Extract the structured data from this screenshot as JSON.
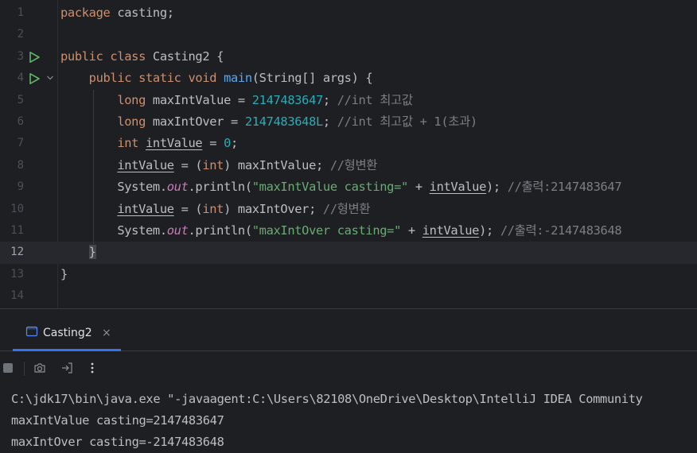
{
  "editor": {
    "lines": [
      {
        "n": "1",
        "html": "<span class=\"kw\">package</span> casting;"
      },
      {
        "n": "2",
        "html": ""
      },
      {
        "n": "3",
        "html": "<span class=\"kw\">public class</span> Casting2 {"
      },
      {
        "n": "4",
        "html": "    <span class=\"kw\">public static void</span> <span class=\"fn\">main</span>(String[] args) {"
      },
      {
        "n": "5",
        "html": "        <span class=\"kw\">long</span> maxIntValue = <span class=\"num\">2147483647</span>; <span class=\"cmt\">//int 최고값</span>"
      },
      {
        "n": "6",
        "html": "        <span class=\"kw\">long</span> maxIntOver = <span class=\"num\">2147483648L</span>; <span class=\"cmt\">//int 최고값 + 1(초과)</span>"
      },
      {
        "n": "7",
        "html": "        <span class=\"kw\">int</span> <span class=\"var\">intValue</span> = <span class=\"num\">0</span>;"
      },
      {
        "n": "8",
        "html": "        <span class=\"var\">intValue</span> = (<span class=\"kw\">int</span>) maxIntValue; <span class=\"cmt\">//형변환</span>"
      },
      {
        "n": "9",
        "html": "        System.<span class=\"fld\">out</span>.println(<span class=\"str\">\"maxIntValue casting=\"</span> + <span class=\"var\">intValue</span>); <span class=\"cmt\">//출력:2147483647</span>"
      },
      {
        "n": "10",
        "html": "        <span class=\"var\">intValue</span> = (<span class=\"kw\">int</span>) maxIntOver; <span class=\"cmt\">//형변환</span>"
      },
      {
        "n": "11",
        "html": "        System.<span class=\"fld\">out</span>.println(<span class=\"str\">\"maxIntOver casting=\"</span> + <span class=\"var\">intValue</span>); <span class=\"cmt\">//출력:-2147483648</span>"
      },
      {
        "n": "12",
        "html": "    <span class=\"bracehl\">}</span>"
      },
      {
        "n": "13",
        "html": "}"
      },
      {
        "n": "14",
        "html": ""
      }
    ],
    "run_gutter_lines": [
      "3",
      "4"
    ],
    "fold_lines": [
      "4"
    ],
    "current_line": "12"
  },
  "run_panel": {
    "tab_label": "Casting2",
    "tab_close": "×",
    "console_lines": [
      "C:\\jdk17\\bin\\java.exe \"-javaagent:C:\\Users\\82108\\OneDrive\\Desktop\\IntelliJ IDEA Community",
      "maxIntValue casting=2147483647",
      "maxIntOver casting=-2147483648"
    ]
  },
  "colors": {
    "keyword": "#cf8e6d",
    "function": "#56a8f5",
    "number": "#2aacb8",
    "string": "#6aab73",
    "comment": "#7a7e85",
    "static_field": "#c77dbb",
    "run_icon": "#5fb865",
    "tab_underline": "#3574f0"
  },
  "icons": {
    "run_gutter": "run-triangle-icon",
    "fold": "chevron-down-icon",
    "tab": "console-icon",
    "stop": "stop-icon",
    "screenshot": "camera-icon",
    "restore": "exit-icon",
    "more": "more-vertical-icon"
  }
}
